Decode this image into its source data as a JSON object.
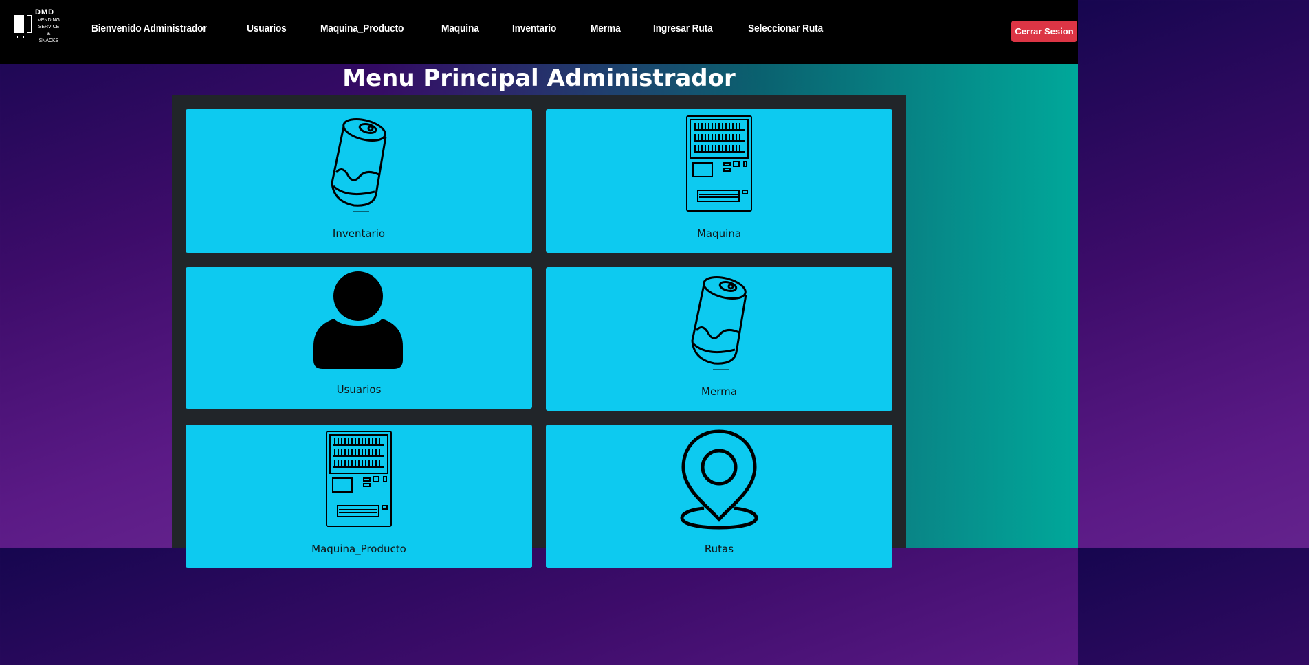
{
  "logo": {
    "brand": "DMD",
    "line1": "VENDING",
    "line2": "SERVICE",
    "line3": "&",
    "line4": "SNACKS"
  },
  "navbar": {
    "links": [
      "Bienvenido Administrador",
      "Usuarios",
      "Maquina_Producto",
      "Maquina",
      "Inventario",
      "Merma",
      "Ingresar Ruta",
      "Seleccionar Ruta"
    ],
    "logout_label": "Cerrar Sesion"
  },
  "page": {
    "title": "Menu Principal Administrador"
  },
  "cards": [
    {
      "label": "Inventario",
      "icon": "soda-can-icon"
    },
    {
      "label": "Maquina",
      "icon": "vending-machine-icon"
    },
    {
      "label": "Usuarios",
      "icon": "user-icon"
    },
    {
      "label": "Merma",
      "icon": "soda-can-icon"
    },
    {
      "label": "Maquina_Producto",
      "icon": "vending-machine-icon"
    },
    {
      "label": "Rutas",
      "icon": "location-pin-icon"
    }
  ],
  "colors": {
    "navbar": "#000000",
    "card": "#0dcaf0",
    "panel": "#212529",
    "logout": "#dc3545"
  }
}
